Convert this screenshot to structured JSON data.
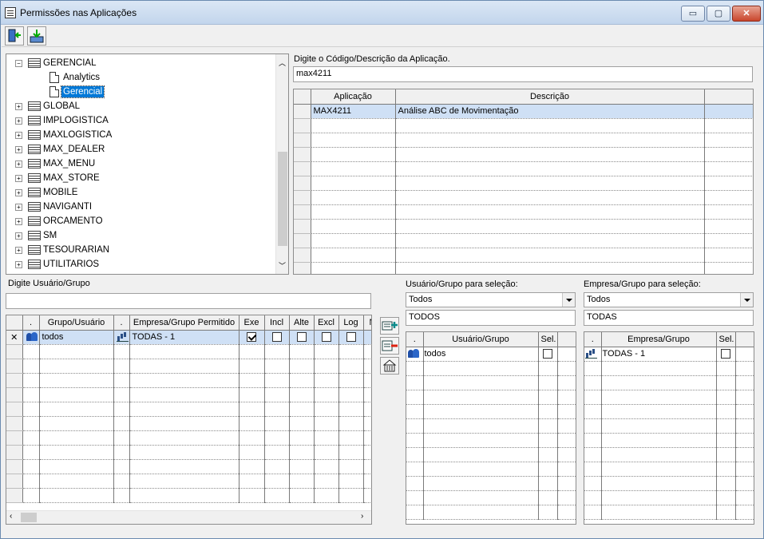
{
  "window": {
    "title": "Permissões nas Aplicações",
    "minimize": "▭",
    "restore": "▢",
    "close": "✕"
  },
  "toolbar": {
    "exit_icon": "exit-door-icon",
    "save_icon": "save-download-icon"
  },
  "tree": {
    "items": [
      {
        "label": "GERENCIAL",
        "expanded": true
      },
      {
        "label": "Analytics"
      },
      {
        "label": "Gerencial",
        "selected": true
      },
      {
        "label": "GLOBAL"
      },
      {
        "label": "IMPLOGISTICA"
      },
      {
        "label": "MAXLOGISTICA"
      },
      {
        "label": "MAX_DEALER"
      },
      {
        "label": "MAX_MENU"
      },
      {
        "label": "MAX_STORE"
      },
      {
        "label": "MOBILE"
      },
      {
        "label": "NAVIGANTI"
      },
      {
        "label": "ORCAMENTO"
      },
      {
        "label": "SM"
      },
      {
        "label": "TESOURARIAN"
      },
      {
        "label": "UTILITARIOS"
      }
    ]
  },
  "app_search": {
    "label": "Digite o Código/Descrição da Aplicação.",
    "value": "max4211"
  },
  "app_grid": {
    "headers": [
      "Aplicação",
      "Descrição"
    ],
    "rows": [
      {
        "app": "MAX4211",
        "desc": "Análise ABC de Movimentação"
      }
    ]
  },
  "user_search": {
    "label": "Digite Usuário/Grupo",
    "value": ""
  },
  "perm_grid": {
    "headers": [
      ".",
      "Grupo/Usuário",
      ".",
      "Empresa/Grupo Permitido",
      "Exe",
      "Incl",
      "Alte",
      "Excl",
      "Log",
      "N"
    ],
    "rows": [
      {
        "marker": "✕",
        "user": "todos",
        "company": "TODAS - 1",
        "exe": true,
        "incl": false,
        "alte": false,
        "excl": false,
        "log": false
      }
    ]
  },
  "user_select": {
    "label": "Usuário/Grupo para seleção:",
    "combo": "Todos",
    "filter": "TODOS",
    "headers": [
      ".",
      "Usuário/Grupo",
      "Sel."
    ],
    "rows": [
      {
        "name": "todos"
      }
    ]
  },
  "company_select": {
    "label": "Empresa/Grupo para seleção:",
    "combo": "Todos",
    "filter": "TODAS",
    "headers": [
      ".",
      "Empresa/Grupo",
      "Sel."
    ],
    "rows": [
      {
        "name": "TODAS - 1"
      }
    ]
  }
}
